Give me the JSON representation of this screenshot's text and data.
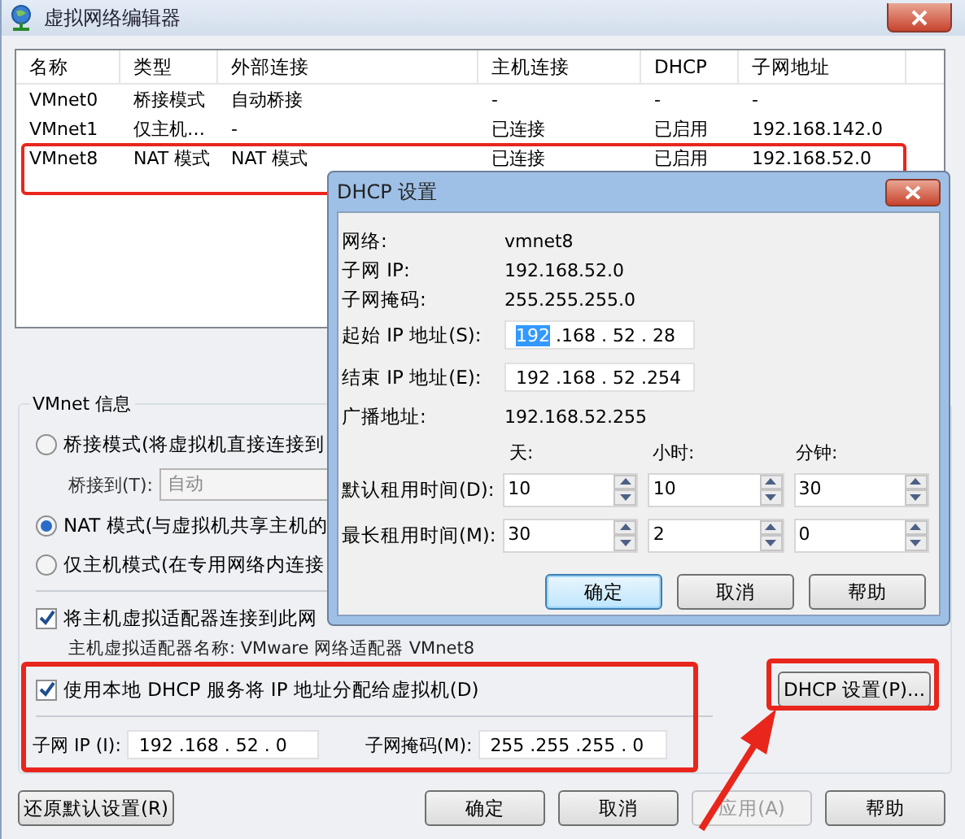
{
  "window": {
    "title": "虚拟网络编辑器"
  },
  "network_table": {
    "columns": [
      "名称",
      "类型",
      "外部连接",
      "主机连接",
      "DHCP",
      "子网地址"
    ],
    "rows": [
      {
        "cells": [
          "VMnet0",
          "桥接模式",
          "自动桥接",
          "-",
          "-",
          "-"
        ]
      },
      {
        "cells": [
          "VMnet1",
          "仅主机…",
          "-",
          "已连接",
          "已启用",
          "192.168.142.0"
        ]
      },
      {
        "cells": [
          "VMnet8",
          "NAT 模式",
          "NAT 模式",
          "已连接",
          "已启用",
          "192.168.52.0"
        ]
      }
    ]
  },
  "vmnet_info": {
    "group_label": "VMnet 信息",
    "modes": [
      {
        "label": "桥接模式(将虚拟机直接连接到",
        "selected": false
      },
      {
        "label": "NAT 模式(与虚拟机共享主机的",
        "selected": true
      },
      {
        "label": "仅主机模式(在专用网络内连接",
        "selected": false
      }
    ],
    "bridge_to": {
      "label": "桥接到(T):",
      "value": "自动",
      "disabled": true
    },
    "host_adapter": {
      "label": "将主机虚拟适配器连接到此网",
      "checked": true
    },
    "adapter_name": "主机虚拟适配器名称: VMware 网络适配器 VMnet8",
    "use_dhcp": {
      "label": "使用本地 DHCP 服务将 IP 地址分配给虚拟机(D)",
      "checked": true
    },
    "dhcp_settings_button": "DHCP 设置(P)...",
    "subnet_ip": {
      "label": "子网 IP (I):",
      "value": "192 .168 . 52 . 0"
    },
    "subnet_mask": {
      "label": "子网掩码(M):",
      "value": "255 .255 .255 . 0"
    }
  },
  "restore_button": "还原默认设置(R)",
  "footer_buttons": [
    {
      "label": "确定",
      "disabled": false
    },
    {
      "label": "取消",
      "disabled": false
    },
    {
      "label": "应用(A)",
      "disabled": true
    },
    {
      "label": "帮助",
      "disabled": false
    }
  ],
  "dhcp_dialog": {
    "title": "DHCP 设置",
    "info": [
      {
        "label": "网络:",
        "value": "vmnet8"
      },
      {
        "label": "子网 IP:",
        "value": "192.168.52.0"
      },
      {
        "label": "子网掩码:",
        "value": "255.255.255.0"
      }
    ],
    "start_ip": {
      "label": "起始 IP 地址(S):",
      "parts": [
        {
          "text": "192",
          "selected": true
        },
        {
          "text": " .168 . 52 . 28",
          "selected": false
        }
      ]
    },
    "end_ip": {
      "label": "结束 IP 地址(E):",
      "parts": [
        {
          "text": "192 .168 . 52 .254",
          "selected": false
        }
      ]
    },
    "broadcast": {
      "label": "广播地址:",
      "value": "192.168.52.255"
    },
    "lease_units": [
      "天:",
      "小时:",
      "分钟:"
    ],
    "leases": [
      {
        "label": "默认租用时间(D):",
        "values": [
          "10",
          "10",
          "30"
        ]
      },
      {
        "label": "最长租用时间(M):",
        "values": [
          "30",
          "2",
          "0"
        ]
      }
    ],
    "buttons": [
      {
        "label": "确定",
        "default": true
      },
      {
        "label": "取消",
        "default": false
      },
      {
        "label": "帮助",
        "default": false
      }
    ]
  }
}
